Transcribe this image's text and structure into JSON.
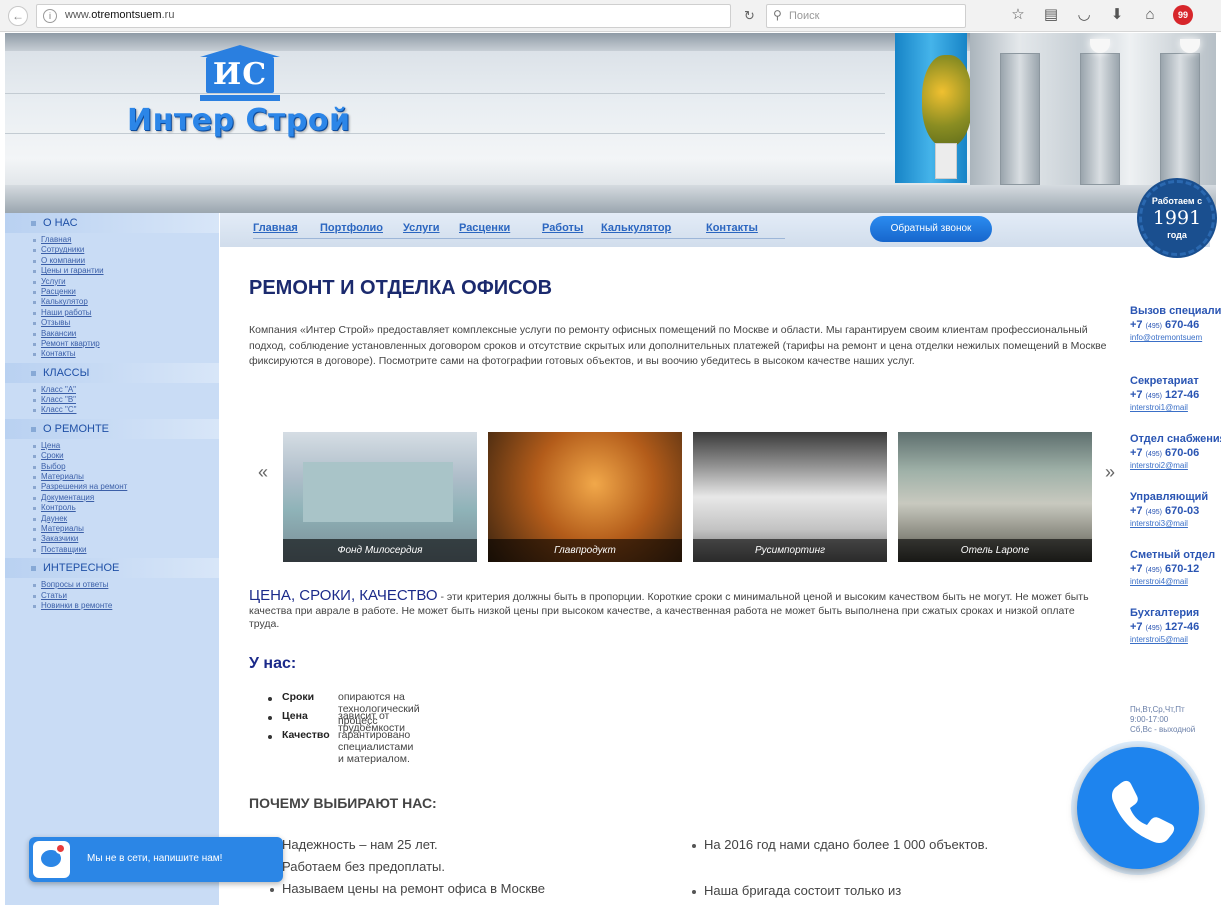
{
  "browser": {
    "url_prefix": "www.",
    "url_domain": "otremontsuem",
    "url_suffix": ".ru",
    "search_placeholder": "Поиск",
    "notif_count": "99"
  },
  "header": {
    "logo_initials": "ИС",
    "logo_name": "Интер Строй",
    "seal_top": "Работаем с",
    "seal_year": "1991",
    "seal_bottom": "года"
  },
  "sidebar": {
    "sections": [
      {
        "title": "О НАС",
        "items": [
          "Главная",
          "Сотрудники",
          "О компании",
          "Цены и гарантии",
          "Услуги",
          "Расценки",
          "Калькулятор",
          "Наши работы",
          "Отзывы",
          "Вакансии",
          "Ремонт квартир",
          "Контакты"
        ]
      },
      {
        "title": "КЛАССЫ",
        "items": [
          "Класс \"А\"",
          "Класс \"B\"",
          "Класс \"C\""
        ]
      },
      {
        "title": "О РЕМОНТЕ",
        "items": [
          "Цена",
          "Сроки",
          "Выбор",
          "Материалы",
          "Разрешения на ремонт",
          "Документация",
          "Контроль",
          "Даунек",
          "Материалы",
          "Заказчики",
          "Поставщики"
        ]
      },
      {
        "title": "ИНТЕРЕСНОЕ",
        "items": [
          "Вопросы и ответы",
          "Статьи",
          "Новинки в ремонте"
        ]
      }
    ]
  },
  "nav": {
    "links": [
      "Главная",
      "Портфолио",
      "Услуги",
      "Расценки",
      "Работы",
      "Калькулятор",
      "Контакты"
    ],
    "callback_label": "Обратный звонок"
  },
  "main": {
    "title": "РЕМОНТ И ОТДЕЛКА ОФИСОВ",
    "intro": "Компания «Интер Строй» предоставляет комплексные услуги по ремонту офисных помещений по Москве и области. Мы гарантируем своим клиентам профессиональный подход, соблюдение установленных договором сроков и отсутствие скрытых или дополнительных платежей (тарифы на ремонт и цена отделки нежилых помещений в Москве фиксируются в договоре). Посмотрите сами на фотографии готовых объектов, и вы воочию убедитесь в высоком качестве наших услуг.",
    "gallery": {
      "prev": "«",
      "next": "»",
      "captions": [
        "Фонд Милосердия",
        "Главпродукт",
        "Русимпортинг",
        "Отель Lapone"
      ]
    },
    "quality_head": "ЦЕНА, СРОКИ, КАЧЕСТВО",
    "quality_text": " - эти критерия должны быть в пропорции. Короткие сроки с минимальной ценой и высоким качеством быть не могут. Не может быть качества при авралe в работе. Не может быть низкой цены при высоком качестве, а качественная работа не может быть выполнена при сжатых сроках и низкой оплате труда.",
    "us_title": "У нас:",
    "us_items": [
      {
        "key": "Сроки",
        "value": "опираются на технологический процесс"
      },
      {
        "key": "Цена",
        "value": "зависит от трудоёмкости"
      },
      {
        "key": "Качество",
        "value": "гарантировано специалистами и материалом."
      }
    ],
    "why_title": "ПОЧЕМУ ВЫБИРАЮТ НАС:",
    "why_left": [
      "Надежность – нам 25 лет.",
      "Работаем без предоплаты.",
      "Называем цены на ремонт офиса в Москве"
    ],
    "why_right": [
      "На 2016 год нами сдано более 1 000 объектов.",
      "Наша бригада состоит только из"
    ]
  },
  "contacts": [
    {
      "title": "Вызов специалиста",
      "phone_code": "(495)",
      "phone_num": "670-46",
      "email": "info@otremontsuem"
    },
    {
      "title": "Секретариат",
      "phone_code": "(495)",
      "phone_num": "127-46",
      "email": "interstroi1@mail"
    },
    {
      "title": "Отдел снабжения",
      "phone_code": "(495)",
      "phone_num": "670-06",
      "email": "interstroi2@mail"
    },
    {
      "title": "Управляющий",
      "phone_code": "(495)",
      "phone_num": "670-03",
      "email": "interstroi3@mail"
    },
    {
      "title": "Сметный отдел",
      "phone_code": "(495)",
      "phone_num": "670-12",
      "email": "interstroi4@mail"
    },
    {
      "title": "Бухгалтерия",
      "phone_code": "(495)",
      "phone_num": "127-46",
      "email": "interstroi5@mail"
    }
  ],
  "hours": [
    "Пн,Вт,Ср,Чт,Пт",
    "9:00-17:00",
    "Сб,Вс - выходной"
  ],
  "chat": {
    "label": "Мы не в сети, напишите нам!"
  },
  "colors": {
    "accent": "#2b86e6",
    "heading": "#1b2a8a",
    "sidebar": "#c9dcf5",
    "link": "#2b66c0"
  }
}
